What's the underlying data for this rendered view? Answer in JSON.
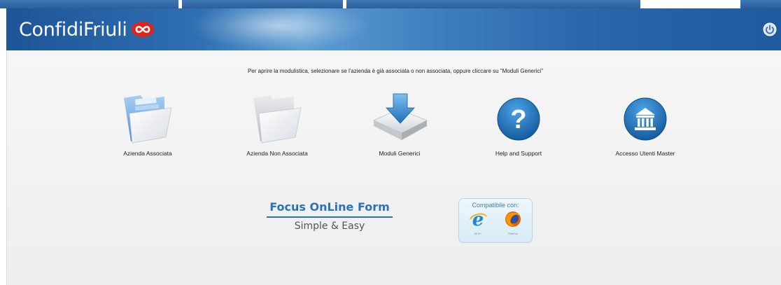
{
  "header": {
    "logo_text": "ConfidiFriuli",
    "brand_color": "#2a66aa",
    "logo_mark_color": "#e2231a",
    "power_icon": "power-icon"
  },
  "instruction": "Per aprire la modulistica, selezionare se l'azienda è già associata o non associata, oppure cliccare su \"Moduli Generici\"",
  "tiles": [
    {
      "label": "Azienda Associata",
      "icon": "blue-folder-icon"
    },
    {
      "label": "Azienda Non Associata",
      "icon": "grey-folder-icon"
    },
    {
      "label": "Moduli Generici",
      "icon": "download-drive-icon"
    },
    {
      "label": "Help and Support",
      "icon": "question-mark-icon"
    },
    {
      "label": "Accesso Utenti Master",
      "icon": "bank-building-icon"
    }
  ],
  "focus": {
    "title": "Focus OnLine Form",
    "subtitle": "Simple & Easy",
    "accent": "#2b73b8"
  },
  "compat": {
    "title": "Compatibile con:",
    "browsers": [
      {
        "name": "IE 9+",
        "icon": "internet-explorer-icon"
      },
      {
        "name": "FireFox",
        "icon": "firefox-icon"
      }
    ]
  }
}
